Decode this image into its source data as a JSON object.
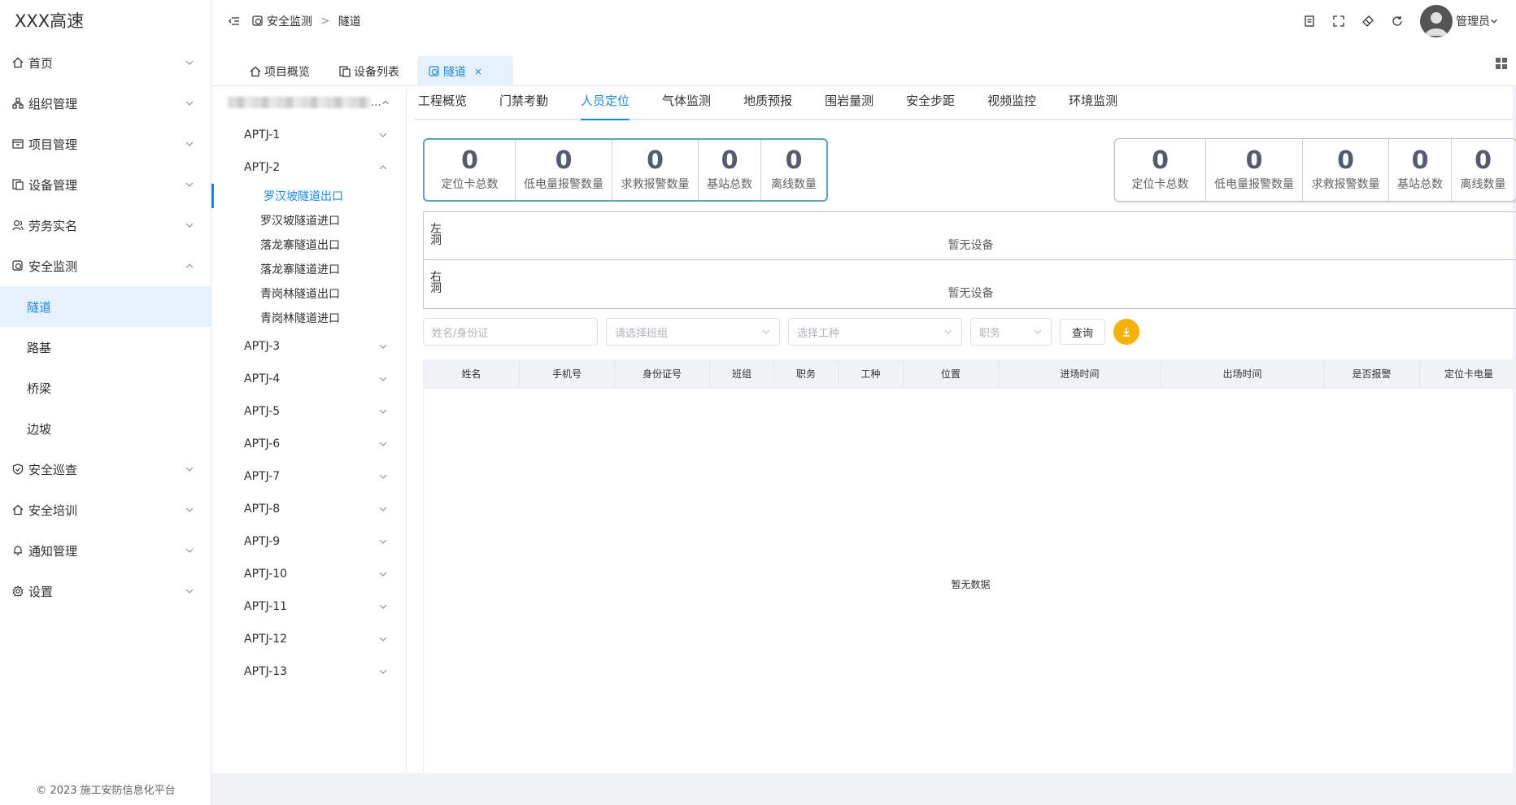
{
  "app": {
    "title": "XXX高速",
    "copyright": "© 2023 施工安防信息化平台"
  },
  "sidebar": {
    "items": [
      {
        "label": "首页",
        "icon": "home-icon"
      },
      {
        "label": "组织管理",
        "icon": "org-icon"
      },
      {
        "label": "项目管理",
        "icon": "project-icon"
      },
      {
        "label": "设备管理",
        "icon": "device-icon"
      },
      {
        "label": "劳务实名",
        "icon": "user-icon"
      },
      {
        "label": "安全监测",
        "icon": "monitor-icon"
      }
    ],
    "submenu": [
      {
        "label": "隧道",
        "active": true
      },
      {
        "label": "路基"
      },
      {
        "label": "桥梁"
      },
      {
        "label": "边坡"
      }
    ],
    "items_after": [
      {
        "label": "安全巡查",
        "icon": "shield-icon"
      },
      {
        "label": "安全培训",
        "icon": "home-icon"
      },
      {
        "label": "通知管理",
        "icon": "bell-icon"
      },
      {
        "label": "设置",
        "icon": "gear-icon"
      }
    ]
  },
  "header": {
    "breadcrumb": [
      "安全监测",
      "隧道"
    ],
    "separator": ">",
    "user": "管理员"
  },
  "tabs": [
    {
      "label": "项目概览"
    },
    {
      "label": "设备列表"
    },
    {
      "label": "隧道",
      "active": true,
      "close": "×"
    }
  ],
  "tree": {
    "root_suffix": "...",
    "nodes_before": [
      "APTJ-1"
    ],
    "expanded": "APTJ-2",
    "leaves": [
      "罗汉坡隧道出口",
      "罗汉坡隧道进口",
      "落龙寨隧道出口",
      "落龙寨隧道进口",
      "青岗林隧道出口",
      "青岗林隧道进口"
    ],
    "nodes_after": [
      "APTJ-3",
      "APTJ-4",
      "APTJ-5",
      "APTJ-6",
      "APTJ-7",
      "APTJ-8",
      "APTJ-9",
      "APTJ-10",
      "APTJ-11",
      "APTJ-12",
      "APTJ-13"
    ]
  },
  "subtabs": [
    "工程概览",
    "门禁考勤",
    "人员定位",
    "气体监测",
    "地质预报",
    "围岩量测",
    "安全步距",
    "视频监控",
    "环境监测"
  ],
  "active_subtab": "人员定位",
  "stats_left": [
    {
      "value": "0",
      "label": "定位卡总数"
    },
    {
      "value": "0",
      "label": "低电量报警数量"
    },
    {
      "value": "0",
      "label": "求救报警数量"
    },
    {
      "value": "0",
      "label": "基站总数"
    },
    {
      "value": "0",
      "label": "离线数量"
    }
  ],
  "stats_right": [
    {
      "value": "0",
      "label": "定位卡总数"
    },
    {
      "value": "0",
      "label": "低电量报警数量"
    },
    {
      "value": "0",
      "label": "求救报警数量"
    },
    {
      "value": "0",
      "label": "基站总数"
    },
    {
      "value": "0",
      "label": "离线数量"
    }
  ],
  "holes": [
    {
      "label": "左洞",
      "empty": "暂无设备"
    },
    {
      "label": "右洞",
      "empty": "暂无设备"
    }
  ],
  "filters": {
    "name_placeholder": "姓名/身份证",
    "team_placeholder": "请选择班组",
    "worktype_placeholder": "选择工种",
    "position_placeholder": "职务",
    "query_label": "查询"
  },
  "table": {
    "columns": [
      "姓名",
      "手机号",
      "身份证号",
      "班组",
      "职务",
      "工种",
      "位置",
      "进场时间",
      "出场时间",
      "是否报警",
      "定位卡电量"
    ],
    "empty": "暂无数据"
  },
  "colors": {
    "accent": "#1e88e5",
    "stat_border": "#5aa6b0",
    "download": "#f5b20a"
  }
}
